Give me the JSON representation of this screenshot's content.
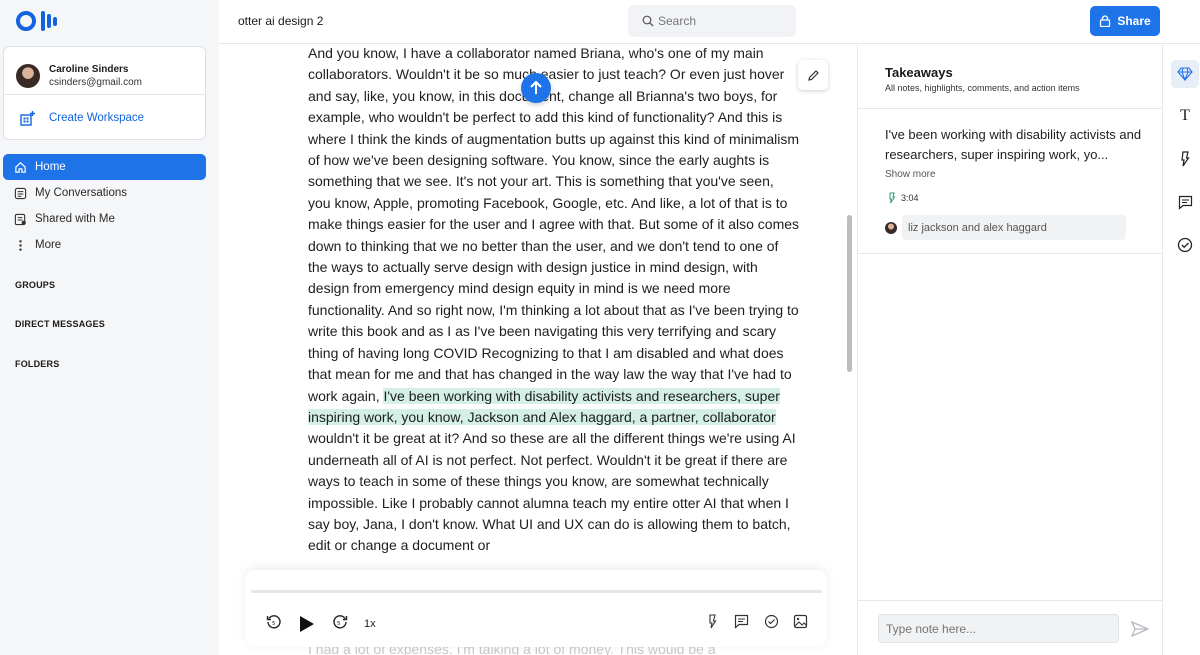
{
  "app": {
    "title": "otter ai design 2",
    "search_placeholder": "Search",
    "share_label": "Share",
    "brand_color": "#1f73e8"
  },
  "sidebar": {
    "account": {
      "name": "Caroline Sinders",
      "email": "csinders@gmail.com"
    },
    "create_workspace": "Create Workspace",
    "nav": [
      {
        "label": "Home",
        "icon": "home-icon",
        "active": true
      },
      {
        "label": "My Conversations",
        "icon": "conversations-icon",
        "active": false
      },
      {
        "label": "Shared with Me",
        "icon": "shared-icon",
        "active": false
      },
      {
        "label": "More",
        "icon": "more-icon",
        "active": false
      }
    ],
    "sections": [
      "GROUPS",
      "DIRECT MESSAGES",
      "FOLDERS"
    ]
  },
  "transcript": {
    "before_highlight": "And you know, I have a collaborator named Briana, who's one of my main collaborators. Wouldn't it be so much easier to just teach? Or even just hover and say, like, you know, in this document, change all Brianna's two boys, for example, who wouldn't be perfect to add this kind of functionality? And this is where I think the kinds of augmentation butts up against this kind of minimalism of how we've been designing software. You know, since the early aughts is something that we see. It's not your art. This is something that you've seen, you know, Apple, promoting Facebook, Google, etc. And like, a lot of that is to make things easier for the user and I agree with that. But some of it also comes down to thinking that we no better than the user, and we don't tend to one of the ways to actually serve design with design justice in mind design, with design from emergency mind design equity in mind is we need more functionality. And so right now, I'm thinking a lot about that as I've been trying to write this book and as I as I've been navigating this very terrifying and scary thing of having long COVID Recognizing to that I am disabled and what does that mean for me and that has changed in the way law the way that I've had to work again, ",
    "highlight": "I've been working with disability activists and researchers, super inspiring work, you know, Jackson and Alex haggard, a partner, collaborator",
    "after_highlight": " wouldn't it be great at it? And so these are all the different things we're using AI underneath all of AI is not perfect. Not perfect. Wouldn't it be great if there are ways to teach in some of these things you know, are somewhat technically impossible. Like I probably cannot alumna teach my entire otter AI that when I say boy, Jana, I don't know. What UI and UX can do is allowing them to batch, edit or change a document or",
    "faded_line": "I had a lot of expenses. I'm talking a lot of money. This would be a"
  },
  "player": {
    "speed": "1x",
    "progress": 0
  },
  "takeaways": {
    "title": "Takeaways",
    "subtitle": "All notes, highlights, comments, and action items",
    "item_text": " I've been working with disability activists and researchers, super inspiring work, yo...",
    "show_more": "Show more",
    "timestamp": "3:04",
    "speakers": "liz jackson and alex haggard",
    "note_placeholder": "Type note here..."
  },
  "rail": [
    "takeaways-icon",
    "text-icon",
    "highlight-icon",
    "comment-icon",
    "action-item-icon"
  ]
}
